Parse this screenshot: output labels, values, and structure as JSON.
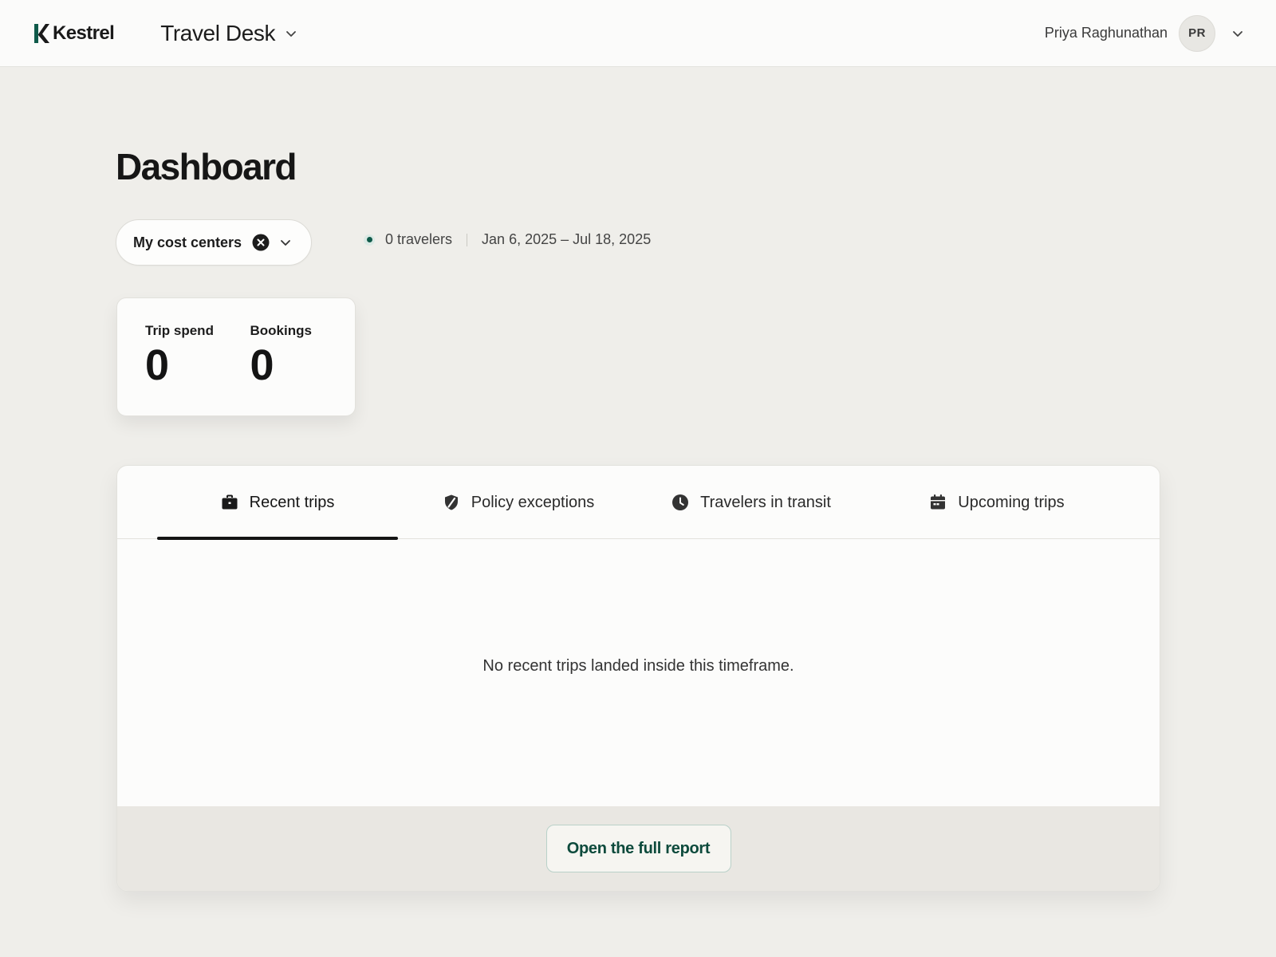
{
  "topbar": {
    "brand": "Kestrel",
    "app_name": "Travel Desk",
    "user_name": "Priya Raghunathan",
    "user_initials": "PR"
  },
  "page": {
    "title": "Dashboard"
  },
  "filters": {
    "cost_center_label": "My cost centers",
    "travelers_count": "0 travelers",
    "date_range": "Jan 6, 2025 – Jul 18, 2025"
  },
  "stats": [
    {
      "label": "Trip spend",
      "value": "0"
    },
    {
      "label": "Bookings",
      "value": "0"
    }
  ],
  "tabs": [
    {
      "label": "Recent trips",
      "icon": "briefcase-icon",
      "active": true
    },
    {
      "label": "Policy exceptions",
      "icon": "shield-icon",
      "active": false
    },
    {
      "label": "Travelers in transit",
      "icon": "clock-icon",
      "active": false
    },
    {
      "label": "Upcoming trips",
      "icon": "calendar-icon",
      "active": false
    }
  ],
  "panel": {
    "empty_message": "No recent trips landed inside this timeframe.",
    "report_button": "Open the full report"
  },
  "colors": {
    "brand_accent": "#0f5a4a",
    "report_text": "#0d4a3c",
    "page_background": "#efeeea"
  }
}
